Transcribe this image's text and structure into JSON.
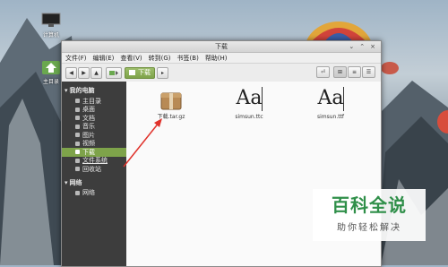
{
  "desktop": {
    "computer_label": "计算机",
    "home_label": "主目录"
  },
  "window": {
    "title": "下载",
    "controls": [
      "⌄",
      "⌃",
      "×"
    ]
  },
  "menu": [
    "文件(F)",
    "编辑(E)",
    "查看(V)",
    "转到(G)",
    "书签(B)",
    "帮助(H)"
  ],
  "toolbar": {
    "back": "◀",
    "forward": "▶",
    "up": "▲",
    "path": [
      "下载"
    ],
    "view_icons": [
      "⊞",
      "≡",
      "☰"
    ]
  },
  "sidebar": {
    "sections": [
      {
        "title": "我的电脑",
        "items": [
          {
            "label": "主目录",
            "selected": false
          },
          {
            "label": "桌面",
            "selected": false
          },
          {
            "label": "文档",
            "selected": false
          },
          {
            "label": "音乐",
            "selected": false
          },
          {
            "label": "图片",
            "selected": false
          },
          {
            "label": "视频",
            "selected": false
          },
          {
            "label": "下载",
            "selected": true
          },
          {
            "label": "文件系统",
            "selected": false
          },
          {
            "label": "回收站",
            "selected": false
          }
        ]
      },
      {
        "title": "网络",
        "items": [
          {
            "label": "网络",
            "selected": false
          }
        ]
      }
    ]
  },
  "files": [
    {
      "name": "下载.tar.gz",
      "type": "archive"
    },
    {
      "name": "simsun.ttc",
      "type": "font",
      "glyph": "Aa"
    },
    {
      "name": "simsun.ttf",
      "type": "font",
      "glyph": "Aa"
    }
  ],
  "watermark": {
    "title": "百科全说",
    "subtitle": "助你轻松解决"
  },
  "colors": {
    "accent_green": "#7ea34a",
    "sidebar_bg": "#3d3d3d",
    "annotation_red": "#e0322b",
    "watermark_green": "#2f8f49"
  }
}
